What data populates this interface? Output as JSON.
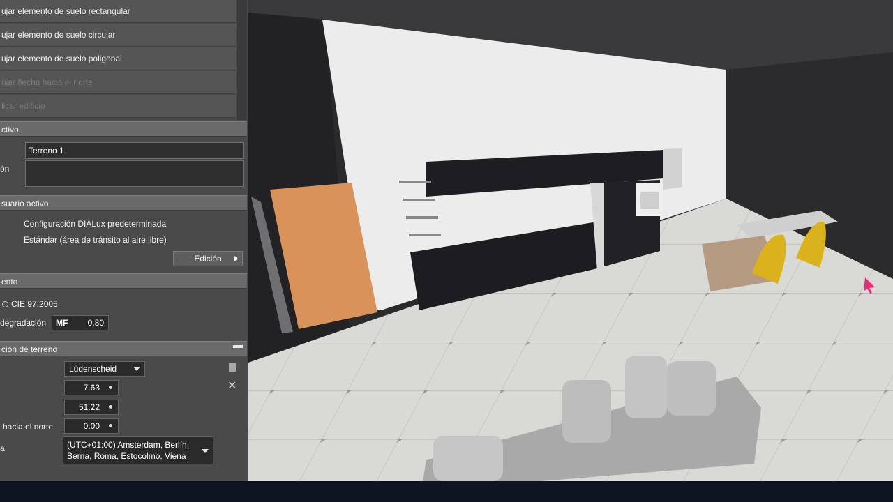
{
  "menu": {
    "items": [
      {
        "label": "ujar elemento de suelo rectangular",
        "disabled": false
      },
      {
        "label": "ujar elemento de suelo circular",
        "disabled": false
      },
      {
        "label": "ujar elemento de suelo poligonal",
        "disabled": false
      },
      {
        "label": "ujar flecha hacia el norte",
        "disabled": true
      },
      {
        "label": "licar edificio",
        "disabled": true
      }
    ]
  },
  "active_object": {
    "header": "ctivo",
    "name_value": "Terreno 1",
    "desc_label": "ón",
    "desc_value": ""
  },
  "user_profile": {
    "header": "suario activo",
    "line1": "Configuración DIALux predeterminada",
    "line2": "Estándar (área de tránsito al aire libre)",
    "edit_button": "Edición"
  },
  "maintenance": {
    "header": "ento",
    "standard": "CIE 97:2005",
    "degradation_label": "degradación",
    "mf_label": "MF",
    "mf_value": "0.80"
  },
  "terrain_location": {
    "header": "ción de terreno",
    "city": "Lüdenscheid",
    "longitude": "7.63",
    "latitude": "51.22",
    "north_label": "hacia el norte",
    "north_value": "0.00",
    "timezone_label": "a",
    "timezone_line1": "(UTC+01:00) Amsterdam, Berlín,",
    "timezone_line2": "Berna, Roma, Estocolmo, Viena"
  },
  "colors": {
    "panel": "#4a4a4a",
    "floor": "#d8d8d4",
    "back_wall": "#ececec",
    "dark_wall": "#2b2a2d",
    "cabinet": "#1e1e22",
    "wood": "#d9925a",
    "chairs": "#d9b21e",
    "sofa": "#a9a9a9",
    "cursor": "#e0307a"
  },
  "icons": [
    "dropdown-caret-icon",
    "spinner-dot-icon",
    "close-icon",
    "document-icon",
    "pin-icon",
    "play-arrow-icon",
    "radio-icon",
    "cursor-icon"
  ]
}
